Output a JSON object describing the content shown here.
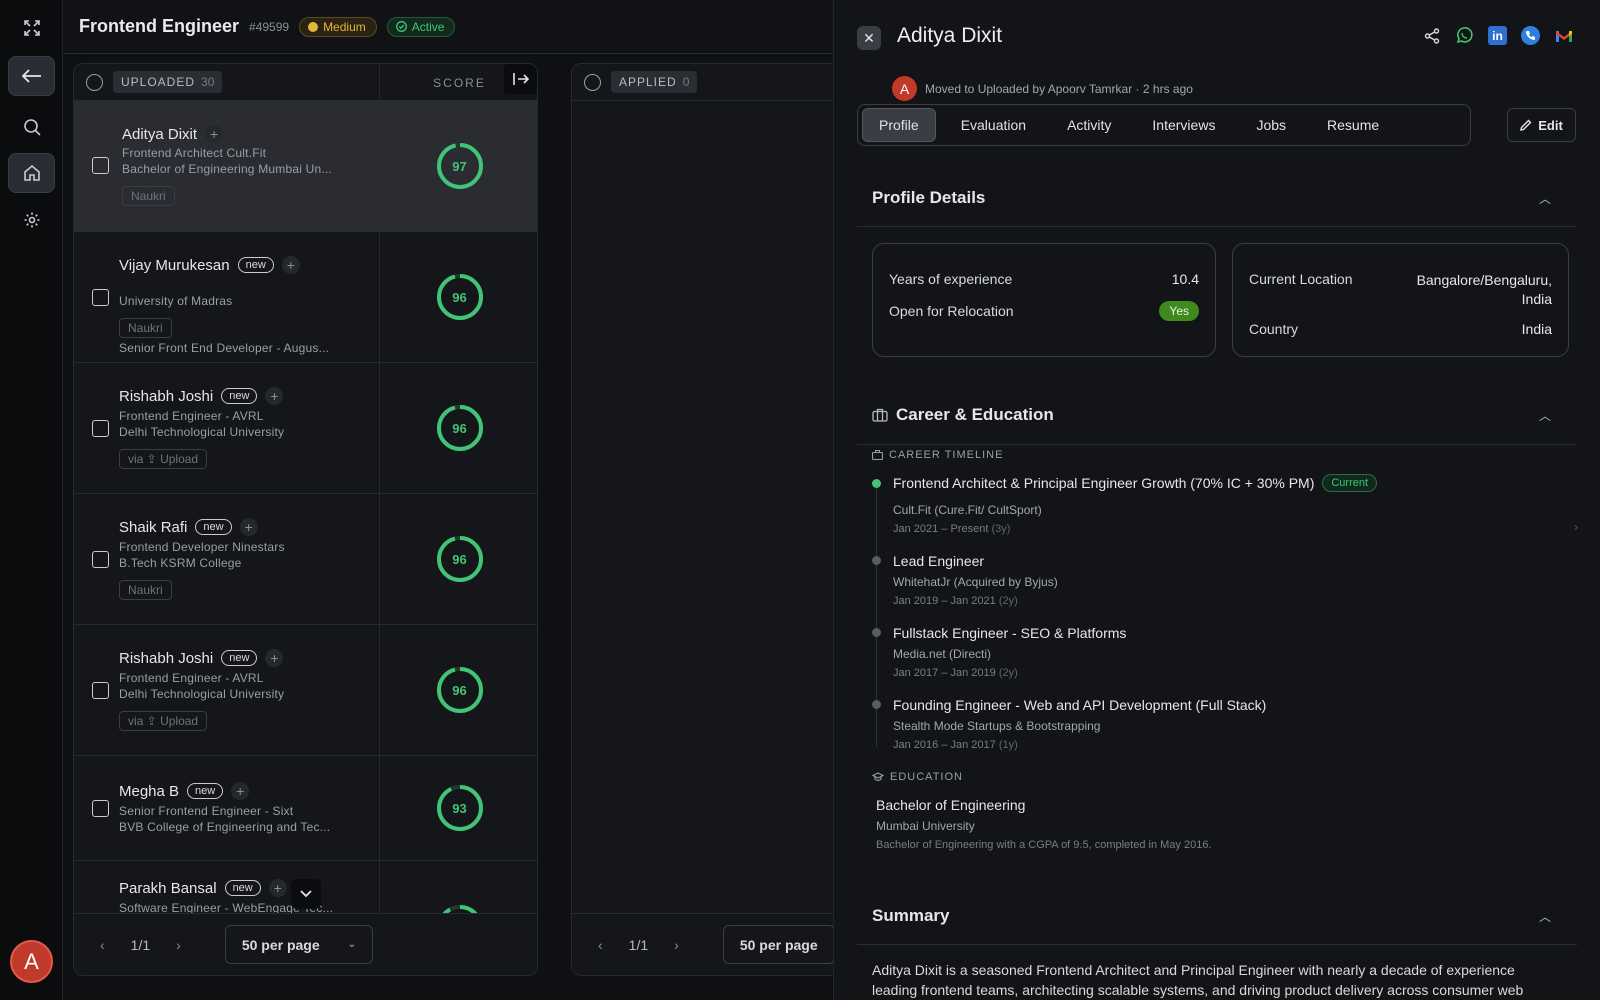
{
  "job": {
    "title": "Frontend Engineer",
    "id": "#49599",
    "priority": "Medium",
    "status": "Active"
  },
  "columns": {
    "uploaded": {
      "label": "UPLOADED",
      "count": "30",
      "score_label": "SCORE"
    },
    "applied": {
      "label": "APPLIED",
      "count": "0"
    }
  },
  "candidates": [
    {
      "name": "Aditya Dixit",
      "is_new": false,
      "line1": "Frontend Architect Cult.Fit",
      "line2": "Bachelor of Engineering Mumbai Un...",
      "source": "Naukri",
      "score": 96.5,
      "score_label": "97"
    },
    {
      "name": "Vijay Murukesan",
      "is_new": true,
      "line1": "Senior Front End Developer - Augus...",
      "line2": "University of Madras",
      "source": "Naukri",
      "score": 96,
      "score_label": "96"
    },
    {
      "name": "Rishabh Joshi",
      "is_new": true,
      "line1": "Frontend Engineer - AVRL",
      "line2": "Delhi Technological University",
      "source": "via ⇪ Upload",
      "score": 96,
      "score_label": "96"
    },
    {
      "name": "Shaik Rafi",
      "is_new": true,
      "line1": "Frontend Developer Ninestars",
      "line2": "B.Tech KSRM College",
      "source": "Naukri",
      "score": 96,
      "score_label": "96"
    },
    {
      "name": "Rishabh Joshi",
      "is_new": true,
      "line1": "Frontend Engineer - AVRL",
      "line2": "Delhi Technological University",
      "source": "via ⇪ Upload",
      "score": 96,
      "score_label": "96"
    },
    {
      "name": "Megha B",
      "is_new": true,
      "line1": "Senior Frontend Engineer - Sixt",
      "line2": "BVB College of Engineering and Tec...",
      "source": "",
      "score": 93,
      "score_label": "93"
    },
    {
      "name": "Parakh Bansal",
      "is_new": true,
      "line1": "Software Engineer - WebEngage Tec...",
      "line2": "",
      "source": "",
      "score": 92,
      "score_label": ""
    }
  ],
  "new_label": "new",
  "pagination": {
    "page": "1/1",
    "per_page": "50 per page"
  },
  "drawer": {
    "name": "Aditya Dixit",
    "avatar_letter": "A",
    "moved_text": "Moved to Uploaded by Apoorv Tamrkar · 2 hrs ago",
    "tabs": [
      "Profile",
      "Evaluation",
      "Activity",
      "Interviews",
      "Jobs",
      "Resume"
    ],
    "active_tab": "Profile",
    "edit_label": "Edit",
    "profile_details": {
      "title": "Profile Details",
      "years_label": "Years of experience",
      "years_value": "10.4",
      "relocation_label": "Open for Relocation",
      "relocation_value": "Yes",
      "location_label": "Current Location",
      "location_value": "Bangalore/Bengaluru, India",
      "country_label": "Country",
      "country_value": "India"
    },
    "career": {
      "title": "Career & Education",
      "timeline_label": "CAREER TIMELINE",
      "current_label": "Current",
      "items": [
        {
          "title": "Frontend Architect & Principal Engineer Growth (70% IC + 30% PM)",
          "company": "Cult.Fit (Cure.Fit/ CultSport)",
          "dates": "Jan 2021 – Present",
          "duration": "(3y)",
          "current": true
        },
        {
          "title": "Lead Engineer",
          "company": "WhitehatJr (Acquired by Byjus)",
          "dates": "Jan 2019 – Jan 2021",
          "duration": "(2y)",
          "current": false
        },
        {
          "title": "Fullstack Engineer - SEO & Platforms",
          "company": "Media.net (Directi)",
          "dates": "Jan 2017 – Jan 2019",
          "duration": "(2y)",
          "current": false
        },
        {
          "title": "Founding Engineer - Web and API Development (Full Stack)",
          "company": "Stealth Mode Startups & Bootstrapping",
          "dates": "Jan 2016 – Jan 2017",
          "duration": "(1y)",
          "current": false
        }
      ],
      "education_label": "EDUCATION",
      "education": {
        "degree": "Bachelor of Engineering",
        "school": "Mumbai University",
        "note": "Bachelor of Engineering with a CGPA of 9.5, completed in May 2016."
      }
    },
    "summary": {
      "title": "Summary",
      "text": "Aditya Dixit is a seasoned Frontend Architect and Principal Engineer with nearly a decade of experience leading frontend teams, architecting scalable systems, and driving product delivery across consumer web"
    }
  },
  "colors": {
    "score_green": "#42c477",
    "accent_red": "#c0392b",
    "medium_amber": "#e5b53a"
  }
}
